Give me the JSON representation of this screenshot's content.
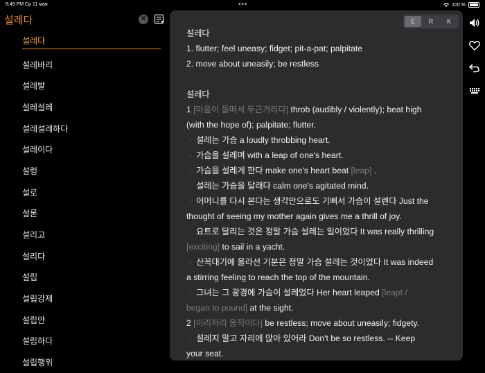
{
  "status": {
    "time": "8:49 PM",
    "date": "Ср 11 мая",
    "battery": "100 %"
  },
  "search": {
    "value": "설레다"
  },
  "sidebar": {
    "items": [
      "설레다",
      "설레바리",
      "설레발",
      "설레설레",
      "설레설레하다",
      "설레이다",
      "설렁",
      "설로",
      "설론",
      "설리고",
      "설리다",
      "설립",
      "설립강제",
      "설립안",
      "설립하다",
      "설립행위"
    ]
  },
  "tabs": [
    "E",
    "R",
    "K"
  ],
  "entry1": {
    "head": "설레다",
    "lines": [
      "1. flutter; feel uneasy; fidget; pit-a-pat; palpitate",
      "2. move about uneasily; be restless"
    ]
  },
  "entry2": {
    "head": "설레다",
    "s1_num": "1",
    "s1_note": "[마음이 들떠서 두근거리다]",
    "s1_text": "throb (audibly / violently); beat high",
    "s1_text2": "(with the hope of); palpitate; flutter.",
    "e1": "설레는 가슴 a loudly throbbing heart.",
    "e2": "가슴을 설레며 with a leap of one's heart.",
    "e3a": "가슴을 설레게 한다 make one's heart beat ",
    "e3n": "[leap]",
    "e3b": " .",
    "e4": "설레는 가슴을 달래다 calm one's agitated mind.",
    "e5a": "어머니를 다시 본다는 생각만으로도 기뻐서 가슴이 설렌다 Just the",
    "e5b": "thought of seeing my mother again gives me a thrill of joy.",
    "e6a": "요트로 달리는 것은 정말 가슴 설레는 일이었다 It was really thrilling",
    "e6n": "[exciting]",
    "e6b": " to sail in a yacht.",
    "e7a": "산꼭대기에 올라선 기분은 정말 가슴 설레는 것이었다 It was indeed",
    "e7b": "a stirring feeling to reach the top of the mountain.",
    "e8a": "그녀는 그 광경에 가슴이 설레었다 Her heart leaped ",
    "e8n1": "[leapt /",
    "e8n2": "began to pound]",
    "e8b": " at the sight.",
    "s2_num": "2",
    "s2_note": "[이리저리 움직이다]",
    "s2_text": "be restless; move about uneasily; fidgety.",
    "e9a": "설레지 말고 자리에 앉아 있어라 Don't be so restless. -- Keep",
    "e9b": "your seat."
  },
  "side_icons": [
    "speaker-icon",
    "heart-icon",
    "back-arrow-icon",
    "keyboard-icon"
  ]
}
